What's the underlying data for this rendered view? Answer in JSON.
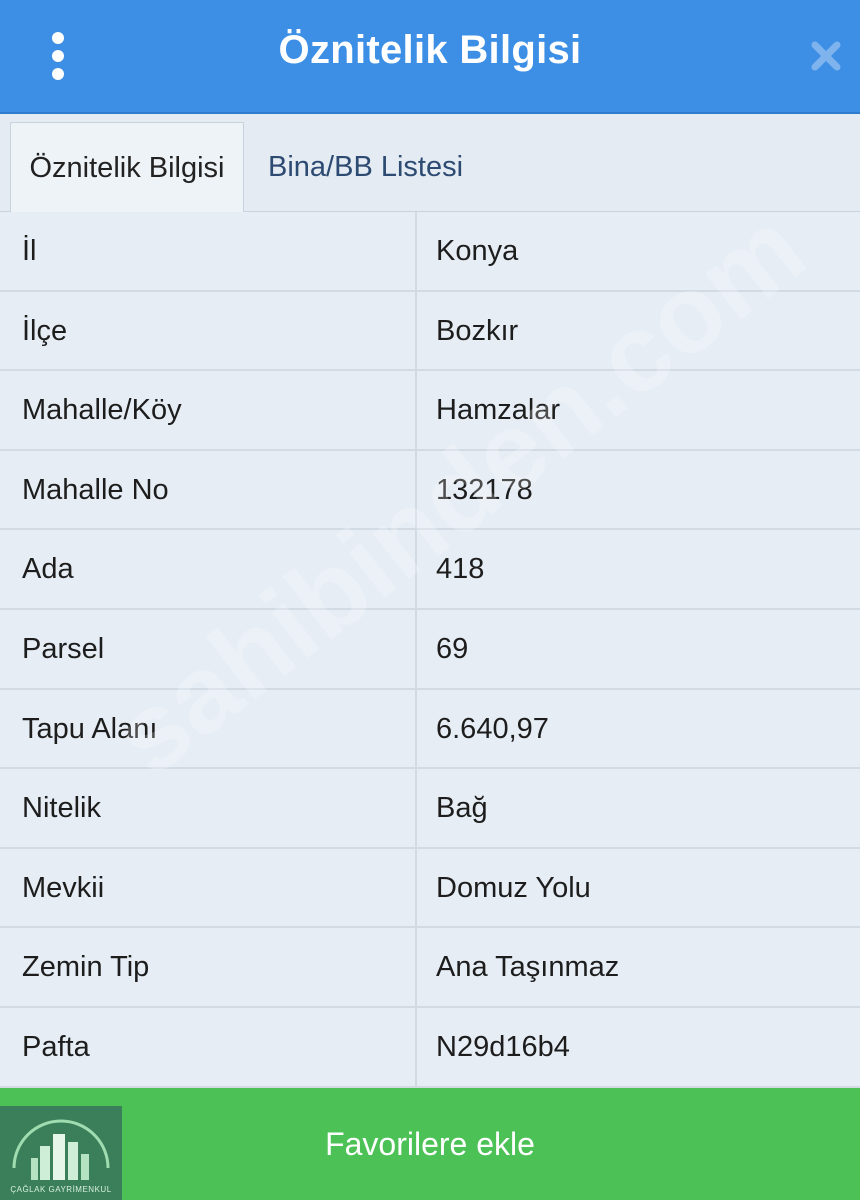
{
  "header": {
    "title": "Öznitelik Bilgisi",
    "menu_icon": "kebab-menu-icon",
    "close_icon": "close-icon",
    "bg_color": "#3d8fe6"
  },
  "tabs": [
    {
      "label": "Öznitelik Bilgisi",
      "active": true
    },
    {
      "label": "Bina/BB Listesi",
      "active": false
    }
  ],
  "rows": [
    {
      "key": "İl",
      "value": "Konya"
    },
    {
      "key": "İlçe",
      "value": "Bozkır"
    },
    {
      "key": "Mahalle/Köy",
      "value": "Hamzalar"
    },
    {
      "key": "Mahalle No",
      "value": "132178"
    },
    {
      "key": "Ada",
      "value": "418"
    },
    {
      "key": "Parsel",
      "value": "69"
    },
    {
      "key": "Tapu Alanı",
      "value": "6.640,97"
    },
    {
      "key": "Nitelik",
      "value": "Bağ"
    },
    {
      "key": "Mevkii",
      "value": "Domuz Yolu"
    },
    {
      "key": "Zemin Tip",
      "value": "Ana Taşınmaz"
    },
    {
      "key": "Pafta",
      "value": "N29d16b4"
    }
  ],
  "footer": {
    "button_label": "Favorilere ekle",
    "bg_color": "#4cc256"
  },
  "logo": {
    "text": "ÇAĞLAK GAYRİMENKUL"
  },
  "watermark": {
    "text": "sahibinden.com"
  }
}
